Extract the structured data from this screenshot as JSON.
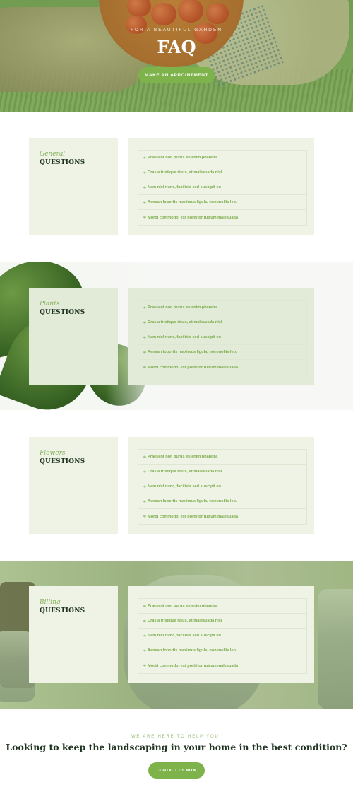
{
  "hero": {
    "eyebrow": "FOR A BEAUTIFUL GARDEN",
    "title": "FAQ",
    "button_label": "MAKE AN APPOINTMENT"
  },
  "sections": [
    {
      "category": "General",
      "heading": "QUESTIONS",
      "items": [
        "Praesent non purus eu enim pharetra",
        "Cras a tristique risus, at malesuada nisl",
        "Nam nisl nunc, facilisis sed suscipit eu",
        "Aenean lobortis maximus ligula, non mollis leo.",
        "Morbi commodo, est porttitor rutrum malesuada"
      ]
    },
    {
      "category": "Plants",
      "heading": "QUESTIONS",
      "items": [
        "Praesent non purus eu enim pharetra",
        "Cras a tristique risus, at malesuada nisl",
        "Nam nisl nunc, facilisis sed suscipit eu",
        "Aenean lobortis maximus ligula, non mollis leo.",
        "Morbi commodo, est porttitor rutrum malesuada"
      ]
    },
    {
      "category": "Flowers",
      "heading": "QUESTIONS",
      "items": [
        "Praesent non purus eu enim pharetra",
        "Cras a tristique risus, at malesuada nisl",
        "Nam nisl nunc, facilisis sed suscipit eu",
        "Aenean lobortis maximus ligula, non mollis leo.",
        "Morbi commodo, est porttitor rutrum malesuada"
      ]
    },
    {
      "category": "Billing",
      "heading": "QUESTIONS",
      "items": [
        "Praesent non purus eu enim pharetra",
        "Cras a tristique risus, at malesuada nisl",
        "Nam nisl nunc, facilisis sed suscipit eu",
        "Aenean lobortis maximus ligula, non mollis leo.",
        "Morbi commodo, est porttitor rutrum malesuada"
      ]
    }
  ],
  "cta": {
    "eyebrow": "WE ARE HERE TO HELP YOU!",
    "title": "Looking to keep the landscaping in your home in the best condition?",
    "button_label": "CONTACT US NOW"
  },
  "colors": {
    "accent": "#7eb24a",
    "heading": "#1f3322",
    "panel_light": "#eef3e6",
    "panel_dark": "#e2ead8"
  }
}
